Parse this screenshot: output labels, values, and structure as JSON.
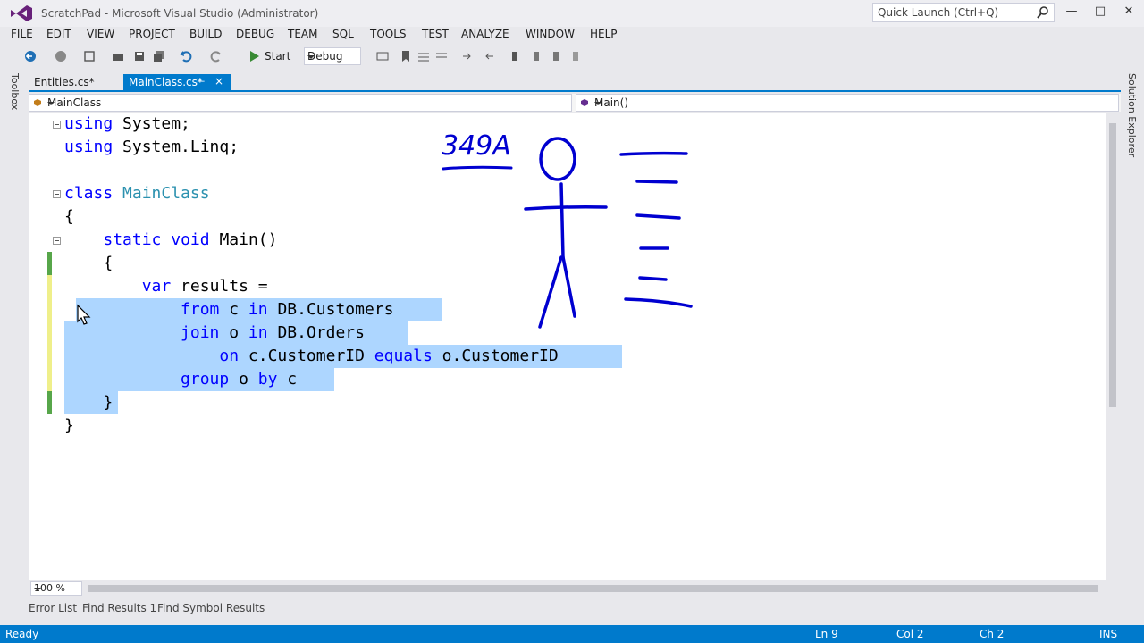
{
  "window": {
    "title": "ScratchPad - Microsoft Visual Studio (Administrator)",
    "quick_launch_placeholder": "Quick Launch (Ctrl+Q)"
  },
  "menu": [
    "FILE",
    "EDIT",
    "VIEW",
    "PROJECT",
    "BUILD",
    "DEBUG",
    "TEAM",
    "SQL",
    "TOOLS",
    "TEST",
    "ANALYZE",
    "WINDOW",
    "HELP"
  ],
  "toolbar": {
    "start_label": "Start",
    "configuration": "Debug"
  },
  "side_panels": {
    "left": "Toolbox",
    "right": "Solution Explorer"
  },
  "tabs": [
    {
      "label": "Entities.cs*",
      "active": false
    },
    {
      "label": "MainClass.cs*",
      "active": true
    }
  ],
  "navbar": {
    "type_combo": "MainClass",
    "member_combo": "Main()"
  },
  "code": {
    "l1": {
      "kw": "using",
      "rest": " System;"
    },
    "l2": {
      "kw": "using",
      "rest": " System.Linq;"
    },
    "l3": {
      "kw": "class",
      "type": "MainClass"
    },
    "l4": "{",
    "l5": {
      "kw1": "static",
      "kw2": "void",
      "rest": "Main()"
    },
    "l6": "{",
    "l7": {
      "kw": "var",
      "rest": " results ="
    },
    "l8": {
      "kw1": "from",
      "a": " c ",
      "kw2": "in",
      "b": " DB.Customers"
    },
    "l9": {
      "kw1": "join",
      "a": " o ",
      "kw2": "in",
      "b": " DB.Orders"
    },
    "l10": {
      "kw1": "on",
      "a": " c.CustomerID ",
      "kw2": "equals",
      "b": " o.CustomerID"
    },
    "l11": {
      "kw1": "group",
      "a": " o ",
      "kw2": "by",
      "b": " c"
    },
    "l12": "}",
    "l13": "}"
  },
  "annotation_text": "349A",
  "zoom": "100 %",
  "bottom_tabs": [
    "Error List",
    "Find Results 1",
    "Find Symbol Results"
  ],
  "status": {
    "state": "Ready",
    "line": "Ln 9",
    "col": "Col 2",
    "ch": "Ch 2",
    "mode": "INS"
  },
  "colors": {
    "accent": "#007acc",
    "keyword": "#0000ff",
    "type": "#2b91af",
    "selection": "#add6ff",
    "ink": "#0000d0"
  }
}
